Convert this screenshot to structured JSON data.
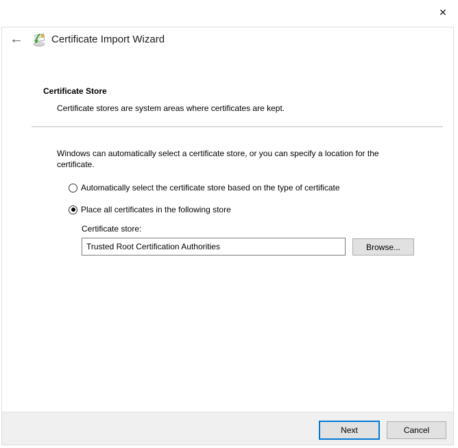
{
  "window": {
    "close_icon": "✕"
  },
  "header": {
    "back_icon": "←",
    "icon": "certificate-import-icon",
    "title": "Certificate Import Wizard"
  },
  "page": {
    "heading": "Certificate Store",
    "subheading": "Certificate stores are system areas where certificates are kept.",
    "intro": "Windows can automatically select a certificate store, or you can specify a location for the certificate.",
    "radio_options": [
      {
        "label": "Automatically select the certificate store based on the type of certificate",
        "selected": false
      },
      {
        "label": "Place all certificates in the following store",
        "selected": true
      }
    ],
    "store_field": {
      "label": "Certificate store:",
      "value": "Trusted Root Certification Authorities"
    },
    "browse_label": "Browse..."
  },
  "footer": {
    "next_label": "Next",
    "cancel_label": "Cancel"
  },
  "colors": {
    "accent": "#0078d7",
    "button_bg": "#e1e1e1",
    "button_border": "#adadad",
    "footer_bg": "#f0f0f0"
  }
}
